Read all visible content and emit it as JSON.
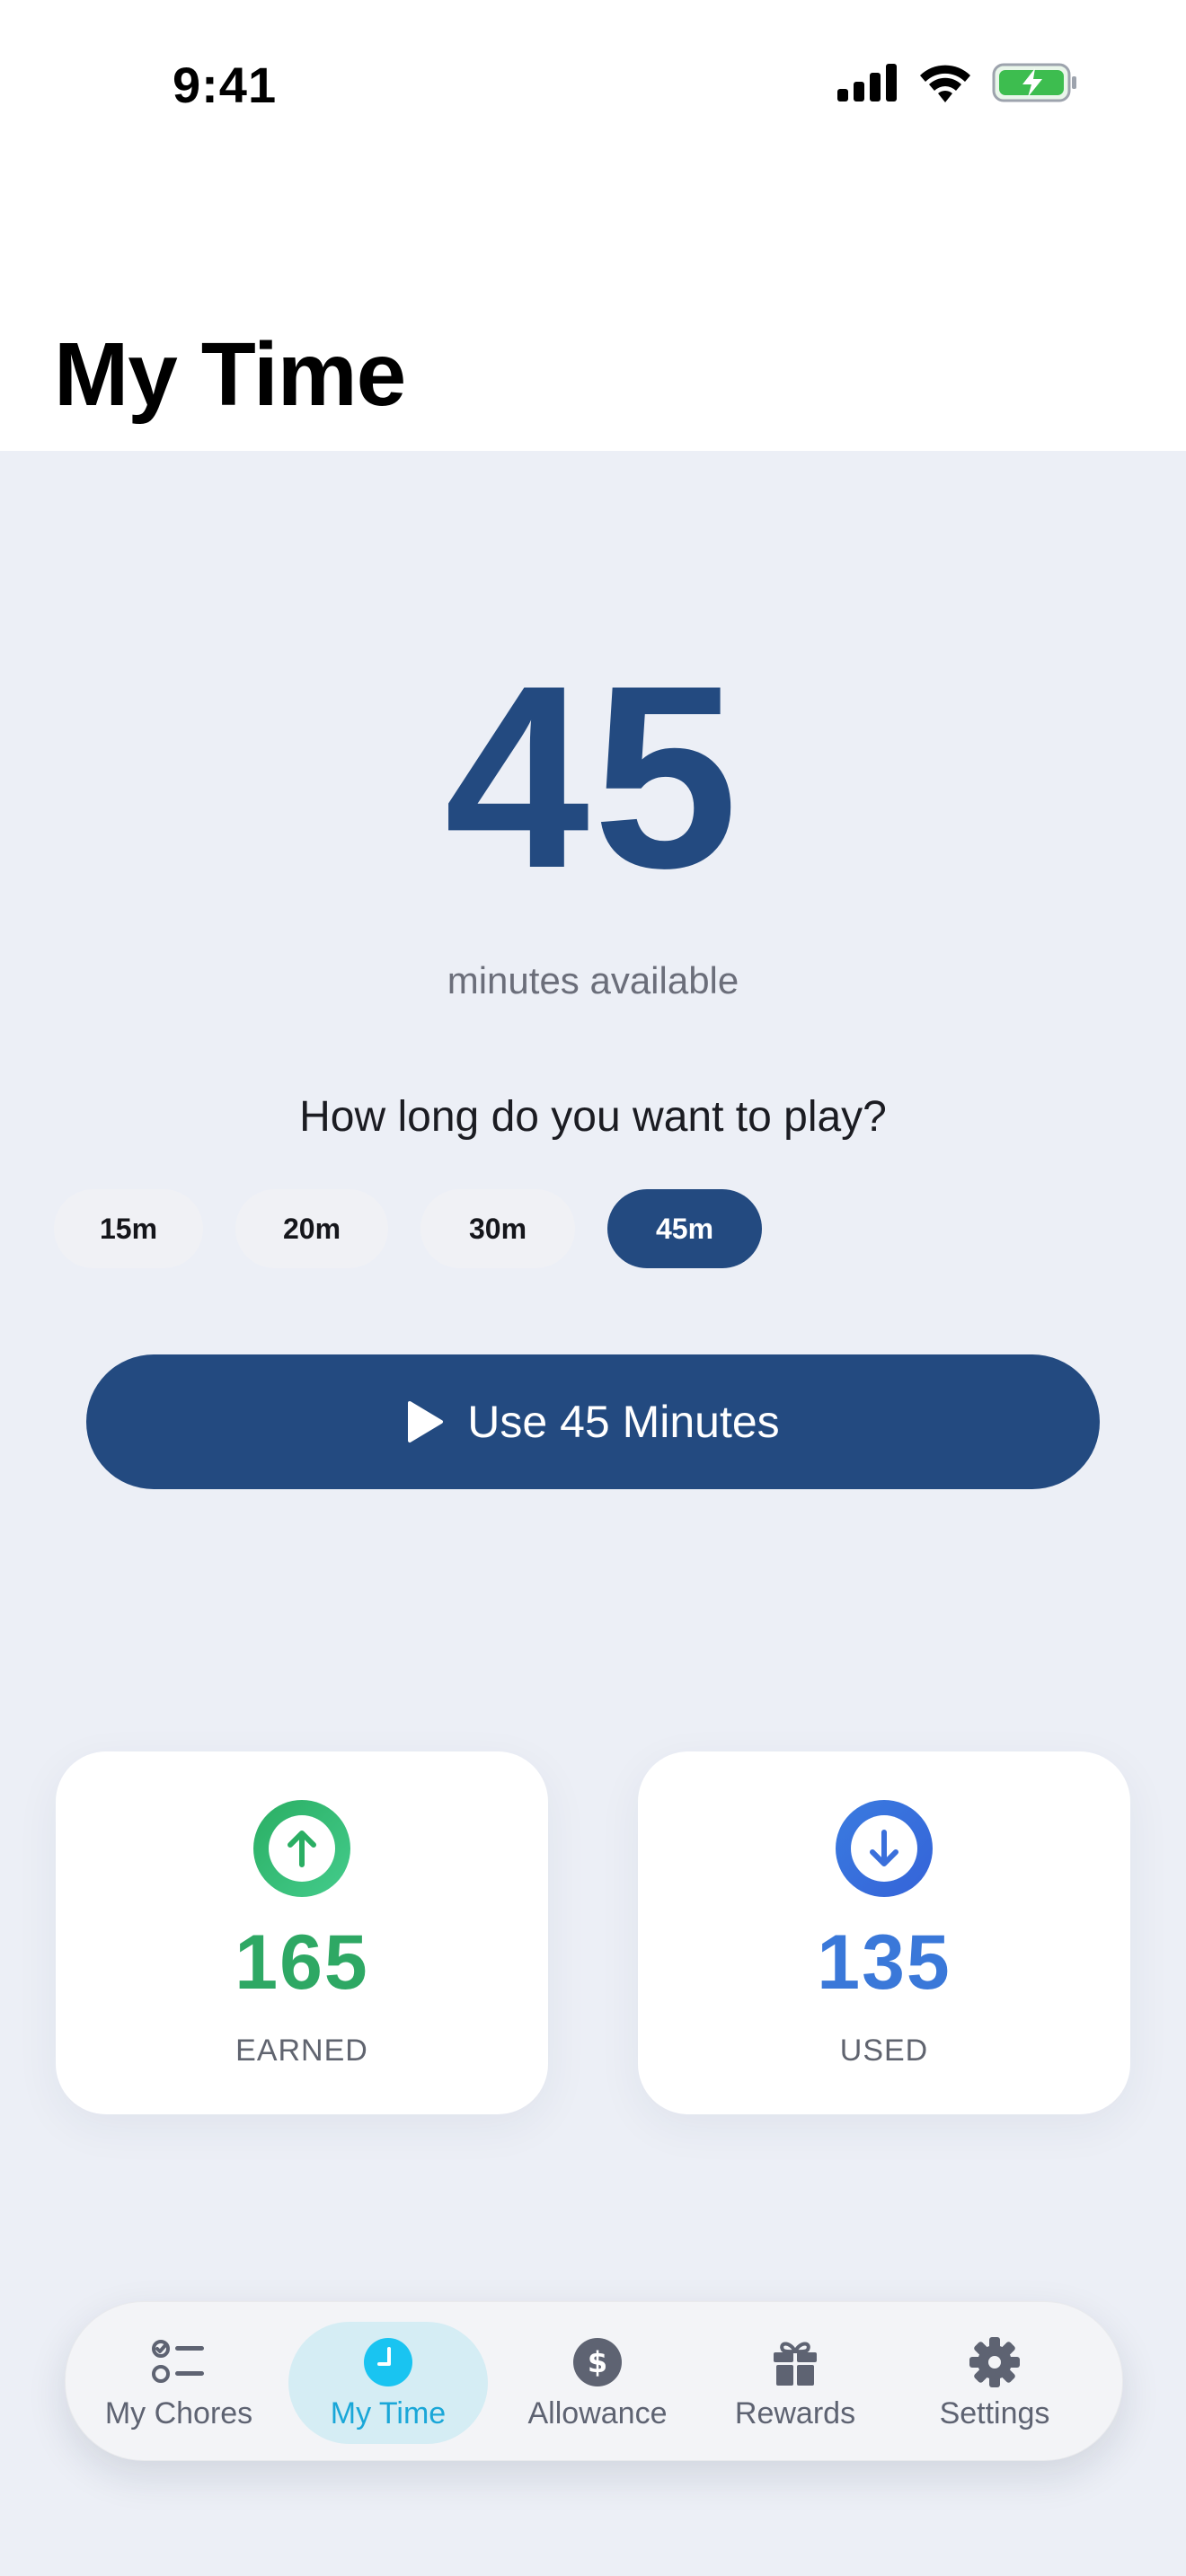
{
  "status_bar": {
    "time": "9:41"
  },
  "header": {
    "title": "My Time"
  },
  "balance": {
    "minutes": "45",
    "label": "minutes available"
  },
  "play": {
    "question": "How long do you want to play?",
    "options": [
      "15m",
      "20m",
      "30m",
      "45m"
    ],
    "selected": "45m",
    "button_label": "Use 45 Minutes"
  },
  "stats": {
    "earned": {
      "value": "165",
      "label": "EARNED",
      "color": "#2EA864"
    },
    "used": {
      "value": "135",
      "label": "USED",
      "color": "#3A78D9"
    }
  },
  "tab_bar": {
    "items": [
      {
        "label": "My Chores",
        "icon": "checklist-icon"
      },
      {
        "label": "My Time",
        "icon": "clock-icon"
      },
      {
        "label": "Allowance",
        "icon": "dollar-icon"
      },
      {
        "label": "Rewards",
        "icon": "gift-icon"
      },
      {
        "label": "Settings",
        "icon": "gear-icon"
      }
    ],
    "active": "My Time"
  },
  "colors": {
    "primary": "#234A80",
    "background": "#ECEFF6",
    "active_tab": "#1AA7D8"
  }
}
